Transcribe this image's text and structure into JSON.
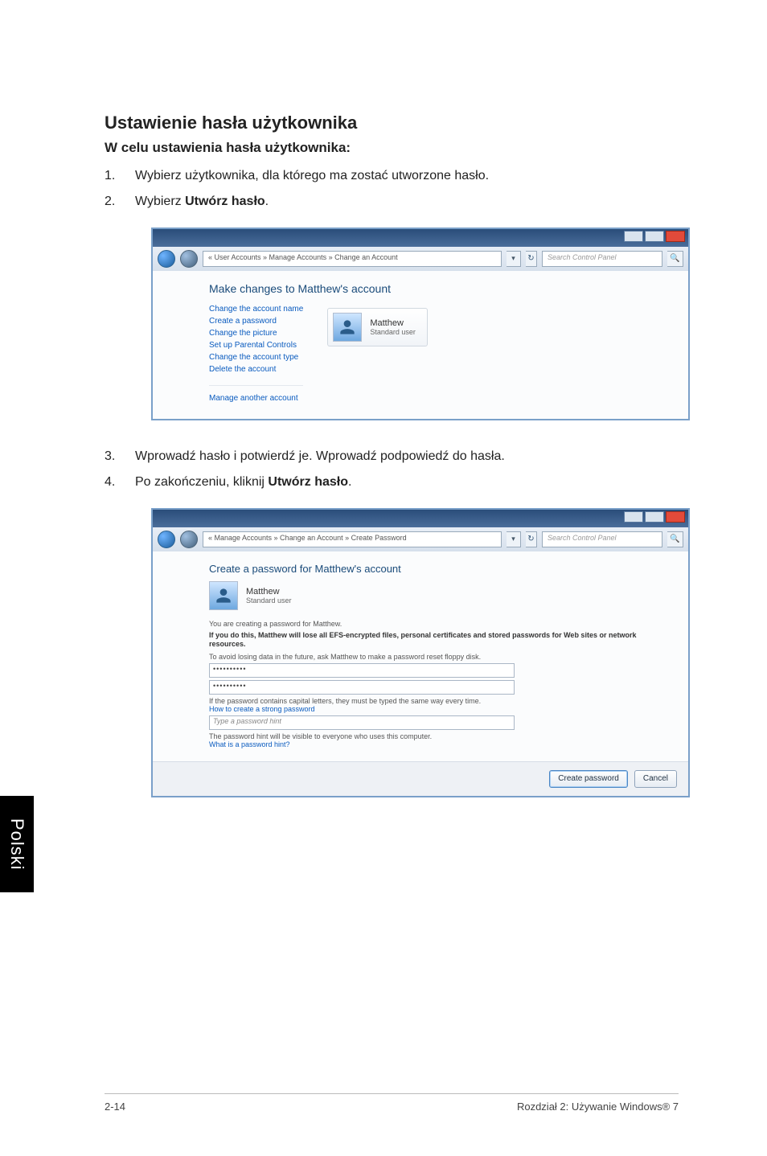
{
  "side_tab": "Polski",
  "heading": "Ustawienie hasła użytkownika",
  "subheading": "W celu ustawienia hasła użytkownika:",
  "steps_a": [
    {
      "num": "1.",
      "text": "Wybierz użytkownika, dla którego ma zostać utworzone hasło."
    },
    {
      "num": "2.",
      "text_pre": "Wybierz ",
      "text_bold": "Utwórz hasło",
      "text_post": "."
    }
  ],
  "steps_b": [
    {
      "num": "3.",
      "text": "Wprowadź hasło i potwierdź je. Wprowadź podpowiedź do hasła."
    },
    {
      "num": "4.",
      "text_pre": "Po zakończeniu, kliknij ",
      "text_bold": "Utwórz hasło",
      "text_post": "."
    }
  ],
  "shot1": {
    "address": "« User Accounts » Manage Accounts » Change an Account",
    "search_placeholder": "Search Control Panel",
    "title": "Make changes to Matthew's account",
    "links": [
      "Change the account name",
      "Create a password",
      "Change the picture",
      "Set up Parental Controls",
      "Change the account type",
      "Delete the account"
    ],
    "manage_link": "Manage another account",
    "account_name": "Matthew",
    "account_type": "Standard user"
  },
  "shot2": {
    "address": "« Manage Accounts » Change an Account » Create Password",
    "search_placeholder": "Search Control Panel",
    "title": "Create a password for Matthew's account",
    "account_name": "Matthew",
    "account_type": "Standard user",
    "line1": "You are creating a password for Matthew.",
    "warn": "If you do this, Matthew will lose all EFS-encrypted files, personal certificates and stored passwords for Web sites or network resources.",
    "line2": "To avoid losing data in the future, ask Matthew to make a password reset floppy disk.",
    "pw_mask": "••••••••••",
    "caps_note": "If the password contains capital letters, they must be typed the same way every time.",
    "caps_link": "How to create a strong password",
    "hint_placeholder": "Type a password hint",
    "hint_note": "The password hint will be visible to everyone who uses this computer.",
    "hint_link": "What is a password hint?",
    "btn_create": "Create password",
    "btn_cancel": "Cancel"
  },
  "footer": {
    "left": "2-14",
    "right": "Rozdział 2: Używanie Windows® 7"
  }
}
